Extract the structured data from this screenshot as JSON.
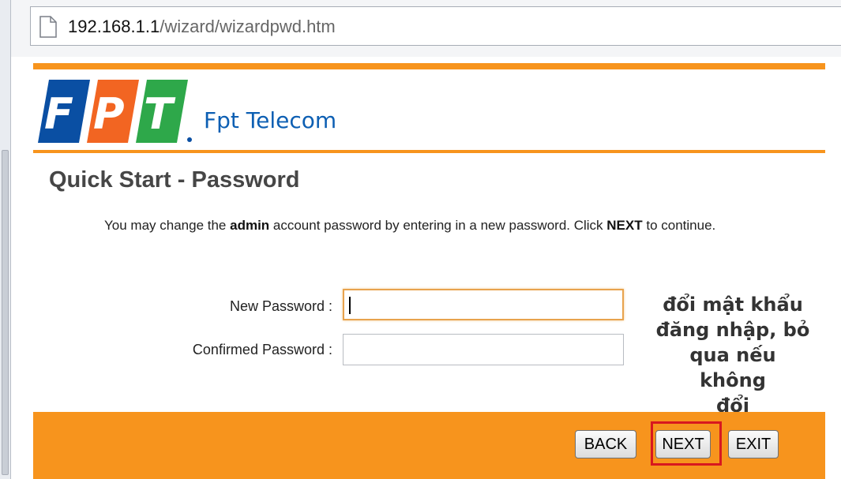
{
  "browser": {
    "url_host": "192.168.1.1",
    "url_path": "/wizard/wizardpwd.htm"
  },
  "brand": {
    "logo_letters": "FPT",
    "name": "Fpt Telecom"
  },
  "page": {
    "title": "Quick Start - Password",
    "description": {
      "part1": "You may change the ",
      "bold1": "admin",
      "part2": " account password by entering in a new password. Click ",
      "bold2": "NEXT",
      "part3": " to continue."
    }
  },
  "form": {
    "new_password_label": "New Password :",
    "new_password_value": "",
    "confirm_password_label": "Confirmed Password :",
    "confirm_password_value": ""
  },
  "annotation": {
    "line1": "đổi mật khẩu",
    "line2": "đăng nhập, bỏ",
    "line3": "qua nếu không",
    "line4": "đổi"
  },
  "buttons": {
    "back": "BACK",
    "next": "NEXT",
    "exit": "EXIT"
  },
  "colors": {
    "accent_orange": "#f7941d",
    "brand_blue": "#0d5fb3",
    "highlight_red": "#d8181f"
  }
}
